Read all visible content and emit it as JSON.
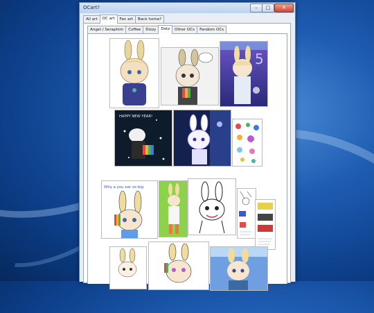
{
  "window": {
    "title": "OCart?"
  },
  "controls": {
    "minimize": "–",
    "maximize": "□",
    "close": "✕"
  },
  "main_tabs": [
    "All art",
    "OC art",
    "Fan art",
    "Back home?"
  ],
  "sub_tabs": [
    "Angel / Seraphim",
    "Coffee",
    "Dizzy",
    "Dotz",
    "Other OCs",
    "Fandom OCs"
  ],
  "artwork": {
    "new_year_text": "HAPPY NEW YEAR!",
    "big_text": "Why a     you ear  so big",
    "number_text": "5"
  },
  "colors": {
    "accent_blue": "#2d6fd1",
    "desktop_blue": "#1f5db3",
    "window_frame": "#5b7fae"
  }
}
